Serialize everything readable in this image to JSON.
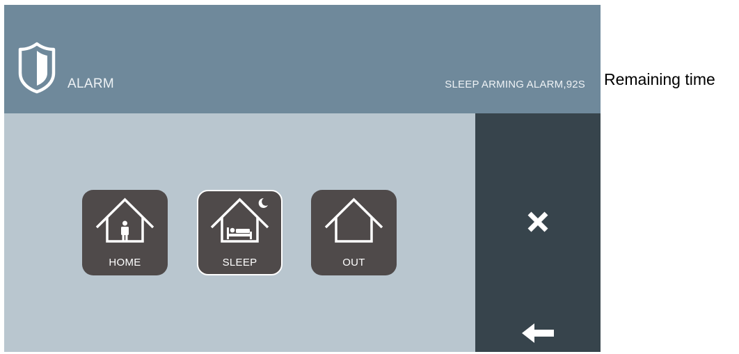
{
  "header": {
    "title": "ALARM",
    "status": "SLEEP ARMING ALARM,92S",
    "icon": "shield-icon"
  },
  "modes": [
    {
      "label": "HOME",
      "icon": "home-person-icon",
      "selected": false
    },
    {
      "label": "SLEEP",
      "icon": "home-sleep-icon",
      "selected": true
    },
    {
      "label": "OUT",
      "icon": "home-empty-icon",
      "selected": false
    }
  ],
  "side_panel": {
    "close_icon": "close-icon",
    "back_icon": "arrow-left-icon"
  },
  "annotation": {
    "text": "Remaining time"
  },
  "colors": {
    "header": "#6f899b",
    "content": "#b9c6cf",
    "side_panel": "#37444c",
    "mode_button": "#4f4a4a",
    "text_light": "#eef2f5"
  }
}
